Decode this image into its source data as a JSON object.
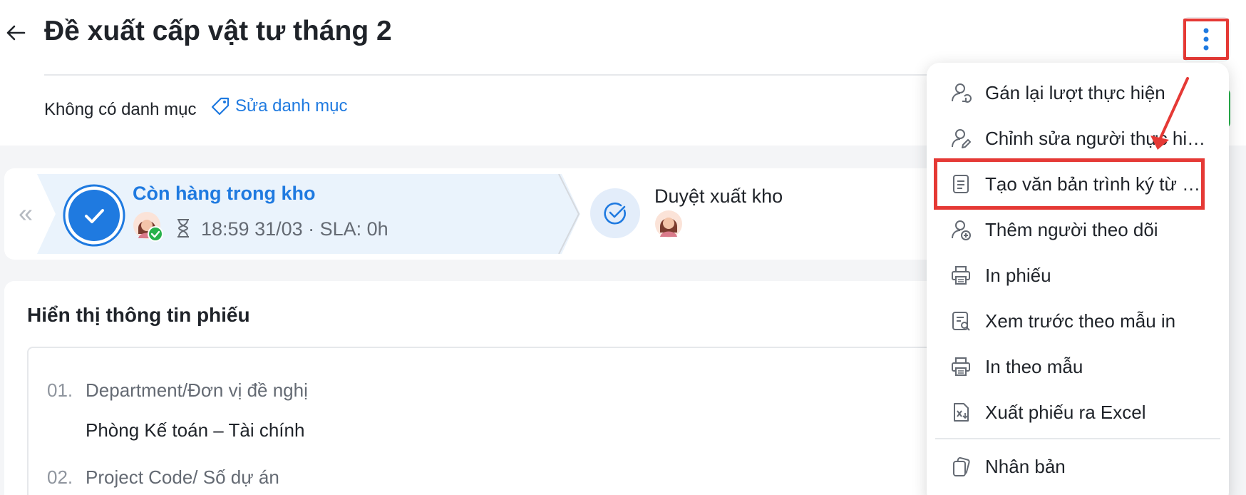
{
  "header": {
    "title": "Đề xuất cấp vật tư tháng 2",
    "category_none": "Không có danh mục",
    "category_edit": "Sửa danh mục"
  },
  "workflow": {
    "step1": {
      "title": "Còn hàng trong kho",
      "meta": "18:59 31/03 · SLA: 0h"
    },
    "step2": {
      "title": "Duyệt xuất kho"
    }
  },
  "content": {
    "section_title": "Hiển thị thông tin phiếu",
    "fields": [
      {
        "num": "01.",
        "label": "Department/Đơn vị đề nghị",
        "value": "Phòng Kế toán – Tài chính"
      },
      {
        "num": "02.",
        "label": "Project Code/ Số dự án",
        "value": ""
      }
    ]
  },
  "menu": {
    "items": [
      {
        "label": "Gán lại lượt thực hiện",
        "icon": "user-reassign-icon"
      },
      {
        "label": "Chỉnh sửa người thực hi…",
        "icon": "user-edit-icon"
      },
      {
        "label": "Tạo văn bản trình ký từ …",
        "icon": "document-icon"
      },
      {
        "label": "Thêm người theo dõi",
        "icon": "user-add-icon"
      },
      {
        "label": "In phiếu",
        "icon": "printer-icon"
      },
      {
        "label": "Xem trước theo mẫu in",
        "icon": "preview-document-icon"
      },
      {
        "label": "In theo mẫu",
        "icon": "printer-icon"
      },
      {
        "label": "Xuất phiếu ra Excel",
        "icon": "excel-icon"
      },
      {
        "label": "Nhân bản",
        "icon": "duplicate-icon"
      }
    ]
  },
  "colors": {
    "accent": "#1f7ae0",
    "highlight": "#e53935",
    "success": "#28b14c"
  }
}
